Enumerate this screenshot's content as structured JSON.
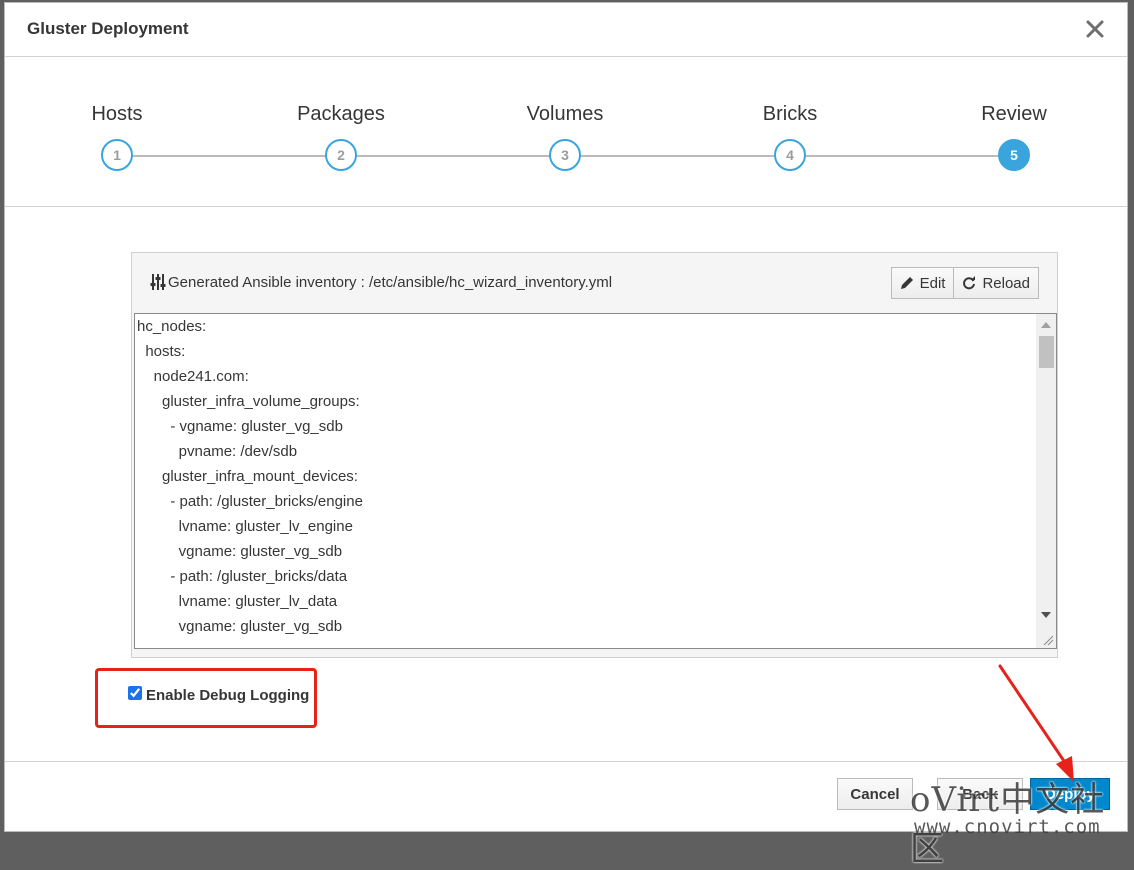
{
  "modal": {
    "title": "Gluster Deployment"
  },
  "wizard": {
    "steps": [
      {
        "label": "Hosts",
        "number": "1",
        "active": false
      },
      {
        "label": "Packages",
        "number": "2",
        "active": false
      },
      {
        "label": "Volumes",
        "number": "3",
        "active": false
      },
      {
        "label": "Bricks",
        "number": "4",
        "active": false
      },
      {
        "label": "Review",
        "number": "5",
        "active": true
      }
    ]
  },
  "inventory": {
    "title": "Generated Ansible inventory : /etc/ansible/hc_wizard_inventory.yml",
    "edit_label": "Edit",
    "reload_label": "Reload",
    "lines": [
      "hc_nodes:",
      "  hosts:",
      "    node241.com:",
      "      gluster_infra_volume_groups:",
      "        - vgname: gluster_vg_sdb",
      "          pvname: /dev/sdb",
      "      gluster_infra_mount_devices:",
      "        - path: /gluster_bricks/engine",
      "          lvname: gluster_lv_engine",
      "          vgname: gluster_vg_sdb",
      "        - path: /gluster_bricks/data",
      "          lvname: gluster_lv_data",
      "          vgname: gluster_vg_sdb"
    ]
  },
  "debug": {
    "label": "Enable Debug Logging",
    "checked": true
  },
  "footer": {
    "cancel_label": "Cancel",
    "back_label": "Back",
    "deploy_label": "Deploy"
  },
  "watermark": {
    "main": "oVirt中文社区",
    "sub": "www.cnovirt.com"
  },
  "colors": {
    "accent": "#39a5dc",
    "primary": "#0088ce",
    "highlight": "#e5231b"
  },
  "icons": {
    "close": "close-icon",
    "inventory": "sliders-icon",
    "edit": "pencil-icon",
    "reload": "refresh-icon"
  }
}
